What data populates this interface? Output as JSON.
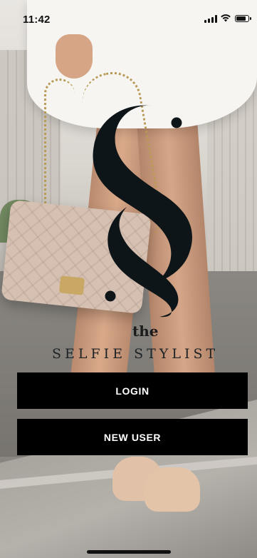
{
  "status_bar": {
    "time": "11:42",
    "signal_icon": "cellular-signal-icon",
    "wifi_icon": "wifi-icon",
    "battery_icon": "battery-icon"
  },
  "logo": {
    "mark_icon": "section-sign-logo",
    "the": "the",
    "name": "SELFIE STYLIST"
  },
  "buttons": {
    "login_label": "LOGIN",
    "new_user_label": "NEW USER"
  },
  "colors": {
    "button_background": "#000000",
    "button_text": "#ffffff",
    "logo": "#0e1518"
  }
}
